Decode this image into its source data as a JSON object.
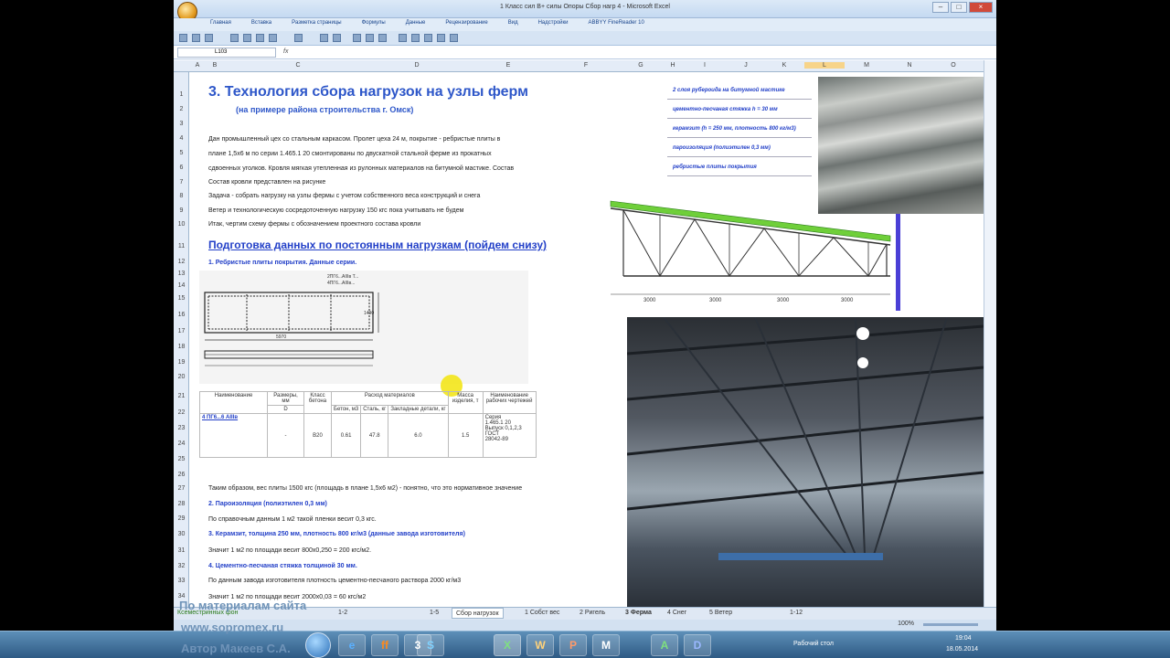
{
  "window": {
    "title": "1 Класс сил В+ силы Опоры Сбор нагр 4 - Microsoft Excel"
  },
  "ribbon": {
    "tabs": [
      "Главная",
      "Вставка",
      "Разметка страницы",
      "Формулы",
      "Данные",
      "Рецензирование",
      "Вид",
      "Надстройки",
      "ABBYY FineReader 10"
    ]
  },
  "formula_bar": {
    "name_box": "L103",
    "fx": "fx",
    "value": ""
  },
  "columns": [
    "A",
    "B",
    "C",
    "D",
    "E",
    "F",
    "G",
    "H",
    "I",
    "J",
    "K",
    "L",
    "M",
    "N",
    "O"
  ],
  "rows": [
    "1",
    "2",
    "3",
    "4",
    "5",
    "6",
    "7",
    "8",
    "9",
    "10",
    "11",
    "12",
    "13",
    "14",
    "15",
    "16",
    "17",
    "18",
    "19",
    "20",
    "21",
    "22",
    "23",
    "24",
    "25",
    "26",
    "27",
    "28",
    "29",
    "30",
    "31",
    "32",
    "33",
    "34"
  ],
  "sheet": {
    "title": "3. Технология сбора нагрузок на узлы ферм",
    "subtitle": "(на примере района строительства г. Омск)",
    "intro": [
      "Дан промышленный цех со стальным каркасом. Пролет цеха 24 м, покрытие - ребристые плиты в",
      "плане 1,5х6 м по серии 1.465.1 20 смонтированы по двускатной стальной ферме из прокатных",
      " сдвоенных уголков. Кровля мягкая утепленная из рулонных материалов на битумной мастике. Состав",
      "Состав кровли представлен на рисунке",
      "Задача - собрать нагрузку на узлы фермы с учетом собственного веса конструкций и снега",
      "Ветер и технологическую сосредоточенную нагрузку 150 кгс пока учитывать не будем",
      "Итак, чертим схему фермы с обозначением проектного состава кровли"
    ],
    "section_title": "Подготовка данных по постоянным нагрузкам (пойдем снизу)",
    "item1": "1. Ребристые плиты покрытия. Данные серии.",
    "text_after_table": "Таким образом, вес плиты 1500 кгс (площадь в плане 1,5х6 м2) - понятно, что это нормативное значение",
    "item2": "2. Пароизоляция (полиэтилен 0,3 мм)",
    "item2_text": "По справочным данным 1 м2 такой пленки весит 0,3 кгс.",
    "item3": "3. Керамзит, толщина 250 мм, плотность 800 кг/м3 (данные завода изготовителя)",
    "item3_text": "Значит 1 м2 по площади весит 800х0,250 = 200 кгс/м2.",
    "item4": "4. Цементно-песчаная стяжка толщиной 30 мм.",
    "item4_text": "По данным завода изготовителя плотность цементно-песчаного раствора 2000 кг/м3",
    "item4_text2": "Значит 1 м2 по площади весит 2000х0,03 = 60 кгс/м2"
  },
  "legend": [
    "2 слоя рубероида на битумной мастике",
    "цементно-песчаная стяжка h = 30 мм",
    "керамзит (h = 250 мм, плотность 800 кг/м3)",
    "пароизоляция (полиэтилен 0,3 мм)",
    "ребристые плиты покрытия"
  ],
  "drawing": {
    "top_label": "2ПГ6...АIIIв Т...",
    "top_label2": "4ПГ6...АIIIв...",
    "dim_length": "5970",
    "dim_side": "1490"
  },
  "truss": {
    "panels": [
      "3000",
      "3000",
      "3000",
      "3000"
    ]
  },
  "table": {
    "headers": [
      "Наименование",
      "Размеры, мм",
      "Класс бетона",
      "Расход материалов",
      "Масса изделия, т",
      "Наименование рабочих чертежей"
    ],
    "subheaders": [
      "D",
      "Бетон, м3",
      "Сталь, кг",
      "Закладные детали, кг"
    ],
    "row": {
      "name": "4 ПГ6...6 АIIIв",
      "size": "-",
      "class": "В20",
      "concrete": "0.61",
      "steel": "47.8",
      "embed": "6.0",
      "mass": "1.5",
      "drawings": [
        "Серия",
        "1.465.1 20",
        "Выпуск 0,1,2,3",
        "ГОСТ",
        "28042-89"
      ]
    }
  },
  "sheet_tabs": {
    "labels": [
      "1-2",
      "1-5",
      "Сбор нагрузок",
      "1 Собст вес",
      "2 Ригель",
      "3 Ферма",
      "4 Снег",
      "5 Ветер",
      "1-12"
    ],
    "active": "Сбор нагрузок",
    "first": "Ксеместринных фон"
  },
  "status": {
    "zoom": "100%"
  },
  "watermark": {
    "line1": "По материалам сайта",
    "line2": "www.sopromex.ru",
    "line3": "Автор Макеев С.А."
  },
  "taskbar": {
    "apps": [
      "e",
      "ff",
      "3",
      "S",
      "X",
      "W",
      "P",
      "M",
      "A",
      "D"
    ],
    "label": "Рабочий стол",
    "time": "19:04",
    "date": "18.05.2014"
  }
}
